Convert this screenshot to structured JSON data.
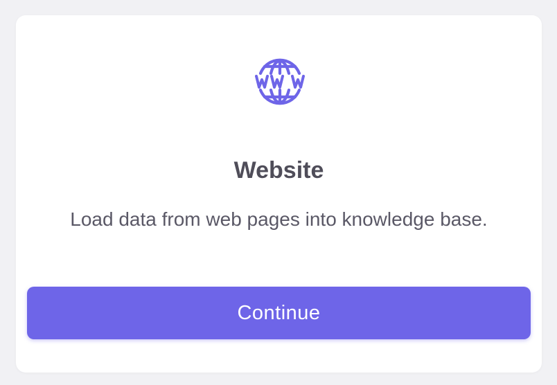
{
  "card": {
    "icon": "www-globe-icon",
    "icon_text": "WWW",
    "title": "Website",
    "description": "Load data from web pages into knowledge base.",
    "button_label": "Continue"
  },
  "colors": {
    "accent": "#6e65e8",
    "title_text": "#4f4d59",
    "body_text": "#5a5866",
    "background": "#f1f1f4",
    "card": "#ffffff"
  }
}
